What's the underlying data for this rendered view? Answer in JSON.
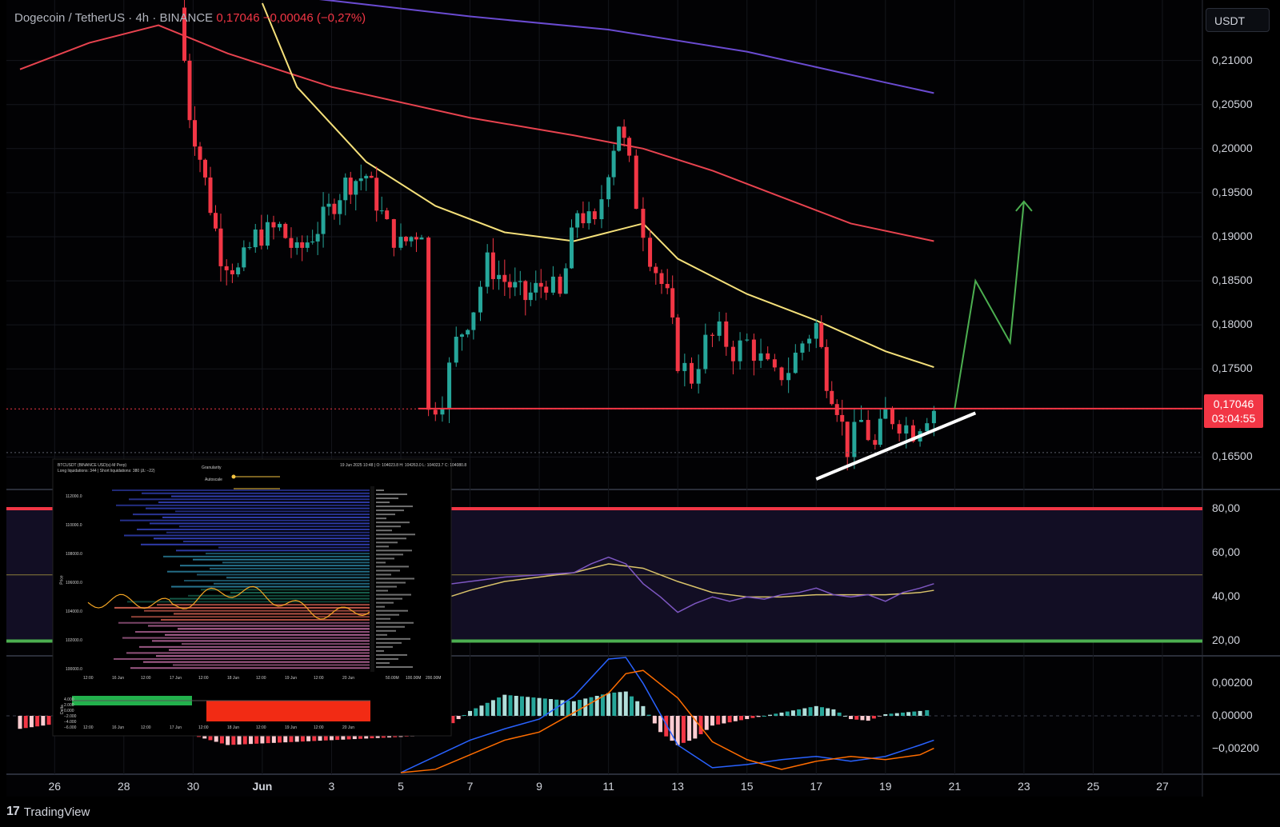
{
  "header": {
    "symbol": "Dogecoin / TetherUS · 4h · BINANCE",
    "last": "0,17046",
    "change": "−0,00046 (−0,27%)"
  },
  "currency_button": "USDT",
  "price_tag": {
    "price": "0,17046",
    "countdown": "03:04:55"
  },
  "brand": {
    "logo": "17",
    "name": "TradingView"
  },
  "inset": {
    "title": "BTCUSDT (BINANCE USD(s)-M Perp)",
    "subtitle": "Long liquidations: 344 | Short liquidations: 380 (Δ: −22)",
    "info": "19 Jun 2025 10:48 | O: 104023.8 H: 104263.0 L: 104023.7 C: 104080.8",
    "granularity": "Granularity",
    "autoscale": "Autoscale",
    "price_ticks": [
      "112000.0",
      "110000.0",
      "108000.0",
      "106000.0",
      "104000.0",
      "102000.0",
      "100000.0"
    ],
    "time_ticks": [
      "12:00",
      "16 Jun",
      "12:00",
      "17 Jun",
      "12:00",
      "18 Jun",
      "12:00",
      "19 Jun",
      "12:00",
      "20 Jun"
    ],
    "vol_ticks": [
      "50.00M",
      "100.00M",
      "200.00M"
    ],
    "delta_ticks": [
      "4.000",
      "2.000",
      "0.000",
      "−2.000",
      "−4.000",
      "−6.000"
    ],
    "y_label": "Price",
    "delta_label": "Delta"
  },
  "colors": {
    "up": "#26a69a",
    "down": "#f23645",
    "ma_yellow": "#f5e07a",
    "ma_red": "#e8434f",
    "ma_purple": "#6a4bd1",
    "trend_green": "#4caf50",
    "trend_white": "#ffffff",
    "rsi": "#7e57c2",
    "rsi_ma": "#d9c36a",
    "macd_hist_up": "#26a69a",
    "macd_hist_down": "#f23645"
  },
  "chart_data": {
    "type": "candlestick",
    "timeframe": "4h",
    "x_ticks": [
      {
        "label": "26",
        "day": 26
      },
      {
        "label": "28",
        "day": 28
      },
      {
        "label": "30",
        "day": 30
      },
      {
        "label": "Jun",
        "day": 32,
        "bold": true
      },
      {
        "label": "3",
        "day": 34
      },
      {
        "label": "5",
        "day": 36
      },
      {
        "label": "7",
        "day": 38
      },
      {
        "label": "9",
        "day": 40
      },
      {
        "label": "11",
        "day": 42
      },
      {
        "label": "13",
        "day": 44
      },
      {
        "label": "15",
        "day": 46
      },
      {
        "label": "17",
        "day": 48
      },
      {
        "label": "19",
        "day": 50
      },
      {
        "label": "21",
        "day": 52
      },
      {
        "label": "23",
        "day": 54
      },
      {
        "label": "25",
        "day": 56
      },
      {
        "label": "27",
        "day": 58
      }
    ],
    "price_axis": {
      "ticks": [
        "0,21000",
        "0,20500",
        "0,20000",
        "0,19500",
        "0,19000",
        "0,18500",
        "0,18000",
        "0,17500",
        "0,16500"
      ],
      "values": [
        0.21,
        0.205,
        0.2,
        0.195,
        0.19,
        0.185,
        0.18,
        0.175,
        0.165
      ],
      "range": [
        0.1615,
        0.2165
      ]
    },
    "rsi_axis": {
      "ticks": [
        "80,00",
        "60,00",
        "40,00",
        "20,00"
      ],
      "values": [
        80,
        60,
        40,
        20
      ],
      "range": [
        14,
        88
      ]
    },
    "macd_axis": {
      "ticks": [
        "0,00200",
        "0,00000",
        "−0,00200"
      ],
      "values": [
        0.002,
        0.0,
        -0.002
      ],
      "range": [
        -0.0035,
        0.0036
      ]
    },
    "candles_path": [
      [
        29.6,
        0.216
      ],
      [
        29.9,
        0.204
      ],
      [
        30.2,
        0.199
      ],
      [
        30.8,
        0.188
      ],
      [
        31.3,
        0.186
      ],
      [
        31.8,
        0.19
      ],
      [
        32.5,
        0.191
      ],
      [
        33.0,
        0.188
      ],
      [
        33.6,
        0.191
      ],
      [
        34.4,
        0.196
      ],
      [
        35.0,
        0.197
      ],
      [
        35.6,
        0.191
      ],
      [
        36.0,
        0.189
      ],
      [
        36.6,
        0.191
      ],
      [
        36.8,
        0.17
      ],
      [
        37.2,
        0.172
      ],
      [
        37.6,
        0.178
      ],
      [
        38.1,
        0.182
      ],
      [
        38.5,
        0.187
      ],
      [
        39.0,
        0.185
      ],
      [
        39.6,
        0.183
      ],
      [
        40.2,
        0.185
      ],
      [
        40.6,
        0.183
      ],
      [
        41.1,
        0.193
      ],
      [
        41.6,
        0.191
      ],
      [
        42.0,
        0.198
      ],
      [
        42.3,
        0.203
      ],
      [
        42.6,
        0.198
      ],
      [
        42.8,
        0.194
      ],
      [
        43.2,
        0.188
      ],
      [
        43.7,
        0.183
      ],
      [
        44.0,
        0.176
      ],
      [
        44.4,
        0.174
      ],
      [
        44.8,
        0.178
      ],
      [
        45.2,
        0.179
      ],
      [
        45.6,
        0.177
      ],
      [
        46.0,
        0.178
      ],
      [
        46.4,
        0.176
      ],
      [
        46.8,
        0.174
      ],
      [
        47.2,
        0.175
      ],
      [
        47.6,
        0.178
      ],
      [
        48.0,
        0.18
      ],
      [
        48.3,
        0.174
      ],
      [
        48.6,
        0.171
      ],
      [
        48.9,
        0.166
      ],
      [
        49.3,
        0.169
      ],
      [
        49.7,
        0.166
      ],
      [
        50.0,
        0.17
      ],
      [
        50.4,
        0.169
      ],
      [
        50.8,
        0.168
      ],
      [
        51.2,
        0.17
      ],
      [
        51.4,
        0.1705
      ]
    ],
    "moving_averages": [
      {
        "color": "#6a4bd1",
        "points": [
          [
            25,
            0.2205
          ],
          [
            30,
            0.2185
          ],
          [
            34,
            0.2168
          ],
          [
            38,
            0.215
          ],
          [
            42,
            0.2135
          ],
          [
            46,
            0.211
          ],
          [
            50,
            0.2075
          ],
          [
            51.4,
            0.2063
          ]
        ]
      },
      {
        "color": "#e8434f",
        "points": [
          [
            25,
            0.209
          ],
          [
            27,
            0.212
          ],
          [
            29,
            0.214
          ],
          [
            31,
            0.2108
          ],
          [
            34,
            0.207
          ],
          [
            38,
            0.2035
          ],
          [
            41,
            0.2015
          ],
          [
            43,
            0.2
          ],
          [
            45,
            0.1975
          ],
          [
            47,
            0.1945
          ],
          [
            49,
            0.1915
          ],
          [
            51.4,
            0.1895
          ]
        ]
      },
      {
        "color": "#f5e07a",
        "points": [
          [
            32,
            0.2165
          ],
          [
            33,
            0.207
          ],
          [
            35,
            0.1985
          ],
          [
            37,
            0.1935
          ],
          [
            39,
            0.1905
          ],
          [
            41,
            0.1895
          ],
          [
            42,
            0.1905
          ],
          [
            43,
            0.1915
          ],
          [
            44,
            0.1875
          ],
          [
            46,
            0.1835
          ],
          [
            48,
            0.1805
          ],
          [
            50,
            0.177
          ],
          [
            51.4,
            0.1752
          ]
        ]
      }
    ],
    "support_level": 0.1705,
    "current_price_line": 0.17046,
    "lower_dotted": 0.1655,
    "trendline_white": [
      [
        48.0,
        0.1625
      ],
      [
        52.6,
        0.17
      ]
    ],
    "projection_green": [
      [
        52.0,
        0.1705
      ],
      [
        52.6,
        0.185
      ],
      [
        53.6,
        0.178
      ],
      [
        54.0,
        0.194
      ]
    ],
    "rsi_levels": [
      80,
      50,
      20
    ],
    "rsi": [
      [
        36,
        29
      ],
      [
        37,
        45
      ],
      [
        38,
        47
      ],
      [
        39,
        49
      ],
      [
        40,
        50
      ],
      [
        41,
        51
      ],
      [
        41.5,
        55
      ],
      [
        42,
        58
      ],
      [
        42.5,
        55
      ],
      [
        43,
        46
      ],
      [
        43.5,
        40
      ],
      [
        44,
        33
      ],
      [
        44.5,
        37
      ],
      [
        45,
        40
      ],
      [
        45.5,
        38
      ],
      [
        46,
        40
      ],
      [
        46.5,
        39
      ],
      [
        47,
        41
      ],
      [
        47.5,
        42
      ],
      [
        48,
        44
      ],
      [
        48.5,
        41
      ],
      [
        49,
        40
      ],
      [
        49.5,
        41
      ],
      [
        50,
        38
      ],
      [
        50.5,
        42
      ],
      [
        51,
        44
      ],
      [
        51.4,
        46
      ]
    ],
    "rsi_ma": [
      [
        36,
        31
      ],
      [
        37,
        38
      ],
      [
        38,
        43
      ],
      [
        39,
        47
      ],
      [
        40,
        49
      ],
      [
        41,
        51
      ],
      [
        42,
        55
      ],
      [
        43,
        53
      ],
      [
        44,
        47
      ],
      [
        45,
        42
      ],
      [
        46,
        40
      ],
      [
        47,
        40
      ],
      [
        48,
        41
      ],
      [
        49,
        41
      ],
      [
        50,
        41
      ],
      [
        51,
        42
      ],
      [
        51.4,
        43
      ]
    ],
    "macd_hist": [
      [
        25,
        -0.0008
      ],
      [
        26,
        -0.0005
      ],
      [
        30,
        -0.0012
      ],
      [
        31,
        -0.0018
      ],
      [
        37,
        -0.0012
      ],
      [
        38,
        0.0003
      ],
      [
        39,
        0.0013
      ],
      [
        40,
        0.0011
      ],
      [
        41,
        0.0009
      ],
      [
        42,
        0.0014
      ],
      [
        42.5,
        0.0015
      ],
      [
        43,
        0.0006
      ],
      [
        43.5,
        -0.001
      ],
      [
        44,
        -0.0018
      ],
      [
        44.5,
        -0.0014
      ],
      [
        45,
        -0.0006
      ],
      [
        46,
        -0.0002
      ],
      [
        47,
        0.0002
      ],
      [
        48,
        0.0006
      ],
      [
        48.5,
        0.0004
      ],
      [
        49,
        -0.0002
      ],
      [
        49.5,
        -0.0003
      ],
      [
        50,
        0.0001
      ],
      [
        51,
        0.0003
      ],
      [
        51.4,
        0.0004
      ]
    ],
    "macd_line": [
      [
        36,
        -0.0035
      ],
      [
        37,
        -0.0025
      ],
      [
        38,
        -0.0015
      ],
      [
        39,
        -0.0008
      ],
      [
        40,
        -0.0002
      ],
      [
        41,
        0.0012
      ],
      [
        42,
        0.0035
      ],
      [
        42.5,
        0.0036
      ],
      [
        43,
        0.002
      ],
      [
        44,
        -0.0018
      ],
      [
        45,
        -0.0032
      ],
      [
        46,
        -0.003
      ],
      [
        47,
        -0.0027
      ],
      [
        48,
        -0.0025
      ],
      [
        49,
        -0.0028
      ],
      [
        50,
        -0.0025
      ],
      [
        51,
        -0.0018
      ],
      [
        51.4,
        -0.0015
      ]
    ],
    "macd_signal": [
      [
        36,
        -0.0035
      ],
      [
        37,
        -0.0033
      ],
      [
        38,
        -0.0024
      ],
      [
        39,
        -0.0015
      ],
      [
        40,
        -0.001
      ],
      [
        41,
        0.0002
      ],
      [
        42,
        0.0014
      ],
      [
        42.5,
        0.0026
      ],
      [
        43,
        0.0028
      ],
      [
        44,
        0.0011
      ],
      [
        45,
        -0.0016
      ],
      [
        46,
        -0.0027
      ],
      [
        47,
        -0.0033
      ],
      [
        48,
        -0.0028
      ],
      [
        49,
        -0.0025
      ],
      [
        50,
        -0.0027
      ],
      [
        51,
        -0.0024
      ],
      [
        51.4,
        -0.002
      ]
    ]
  }
}
